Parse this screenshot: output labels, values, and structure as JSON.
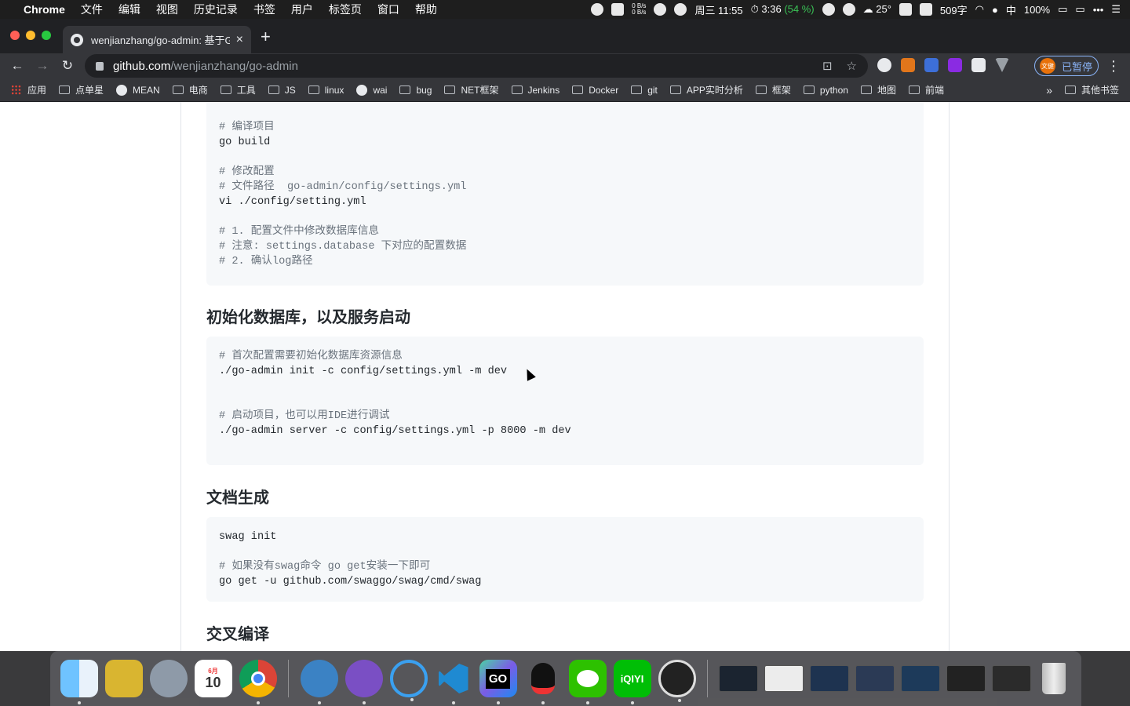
{
  "menubar": {
    "app_name": "Chrome",
    "menus": [
      "文件",
      "编辑",
      "视图",
      "历史记录",
      "书签",
      "用户",
      "标签页",
      "窗口",
      "帮助"
    ],
    "net_up": "0 B/s",
    "net_down": "0 B/s",
    "datetime": "周三 11:55",
    "timer": "3:36",
    "timer_pct": "(54 %)",
    "weather": "25°",
    "word_count": "509字",
    "ime": "中",
    "battery": "100%"
  },
  "tab": {
    "title": "wenjianzhang/go-admin: 基于Gin",
    "close": "×",
    "new": "+"
  },
  "omnibox": {
    "domain": "github.com",
    "path": "/wenjianzhang/go-admin"
  },
  "profile": {
    "avatar_text": "文健",
    "label": "已暂停"
  },
  "bookmarks": {
    "items": [
      {
        "label": "应用",
        "icon": "apps-grid-icon"
      },
      {
        "label": "点单星",
        "icon": "folder-icon"
      },
      {
        "label": "MEAN",
        "icon": "globe-icon"
      },
      {
        "label": "电商",
        "icon": "folder-icon"
      },
      {
        "label": "工具",
        "icon": "folder-icon"
      },
      {
        "label": "JS",
        "icon": "folder-icon"
      },
      {
        "label": "linux",
        "icon": "folder-icon"
      },
      {
        "label": "wai",
        "icon": "globe-icon"
      },
      {
        "label": "bug",
        "icon": "folder-icon"
      },
      {
        "label": "NET框架",
        "icon": "folder-icon"
      },
      {
        "label": "Jenkins",
        "icon": "folder-icon"
      },
      {
        "label": "Docker",
        "icon": "folder-icon"
      },
      {
        "label": "git",
        "icon": "folder-icon"
      },
      {
        "label": "APP实时分析",
        "icon": "folder-icon"
      },
      {
        "label": "框架",
        "icon": "folder-icon"
      },
      {
        "label": "python",
        "icon": "folder-icon"
      },
      {
        "label": "地图",
        "icon": "folder-icon"
      },
      {
        "label": "前端",
        "icon": "folder-icon"
      }
    ],
    "more": "»",
    "other": "其他书签"
  },
  "readme": {
    "block1": {
      "l1": "# 编译项目",
      "l2": "go build",
      "l3": "# 修改配置",
      "l4": "# 文件路径  go-admin/config/settings.yml",
      "l5": "vi ./config/setting.yml",
      "l6": "# 1. 配置文件中修改数据库信息",
      "l7": "# 注意: settings.database 下对应的配置数据",
      "l8": "# 2. 确认log路径"
    },
    "heading_init": "初始化数据库，以及服务启动",
    "block2": {
      "l1": "# 首次配置需要初始化数据库资源信息",
      "l2": "./go-admin init -c config/settings.yml -m dev",
      "l3": "# 启动项目，也可以用IDE进行调试",
      "l4": "./go-admin server -c config/settings.yml -p 8000 -m dev"
    },
    "heading_docs": "文档生成",
    "block3": {
      "l1": "swag init",
      "l2": "# 如果没有swag命令 go get安装一下即可",
      "l3": "go get -u github.com/swaggo/swag/cmd/swag"
    },
    "heading_cross": "交叉编译"
  },
  "dock": {
    "calendar_month": "6月",
    "calendar_day": "10",
    "goland_label": "GO",
    "iqiyi_label": "iQIYI"
  },
  "colors": {
    "page_bg": "#ffffff",
    "code_bg": "#f6f8fa",
    "comment": "#6a737d",
    "chrome_dark": "#202124",
    "chrome_toolbar": "#35363a"
  }
}
